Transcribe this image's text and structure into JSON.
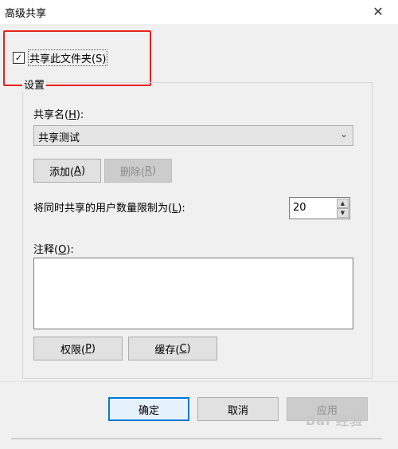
{
  "window": {
    "title": "高级共享",
    "close_glyph": "✕"
  },
  "share_checkbox": {
    "label": "共享此文件夹(S)",
    "checked": true,
    "check_glyph": "✓"
  },
  "settings_group": {
    "title": "设置"
  },
  "share_name": {
    "label_prefix": "共享名(",
    "label_key": "H",
    "label_suffix": "):",
    "value": "共享测试",
    "arrow_glyph": "⌄"
  },
  "buttons": {
    "add": {
      "label_prefix": "添加(",
      "key": "A",
      "label_suffix": ")"
    },
    "remove": {
      "label_prefix": "删除(",
      "key": "R",
      "label_suffix": ")"
    },
    "permissions": {
      "label_prefix": "权限(",
      "key": "P",
      "label_suffix": ")"
    },
    "caching": {
      "label_prefix": "缓存(",
      "key": "C",
      "label_suffix": ")"
    },
    "ok": {
      "label": "确定"
    },
    "cancel": {
      "label": "取消"
    },
    "apply": {
      "label": "应用"
    }
  },
  "user_limit": {
    "label_prefix": "将同时共享的用户数量限制为(",
    "label_key": "L",
    "label_suffix": "):",
    "value": "20",
    "up_glyph": "▲",
    "down_glyph": "▼"
  },
  "comments": {
    "label_prefix": "注释(",
    "label_key": "O",
    "label_suffix": "):",
    "value": ""
  },
  "colors": {
    "highlight_box": "#e8231b",
    "default_button_border": "#0078d7",
    "dialog_bg": "#f0f0f0"
  },
  "watermark": {
    "text": "Bai 经验"
  }
}
